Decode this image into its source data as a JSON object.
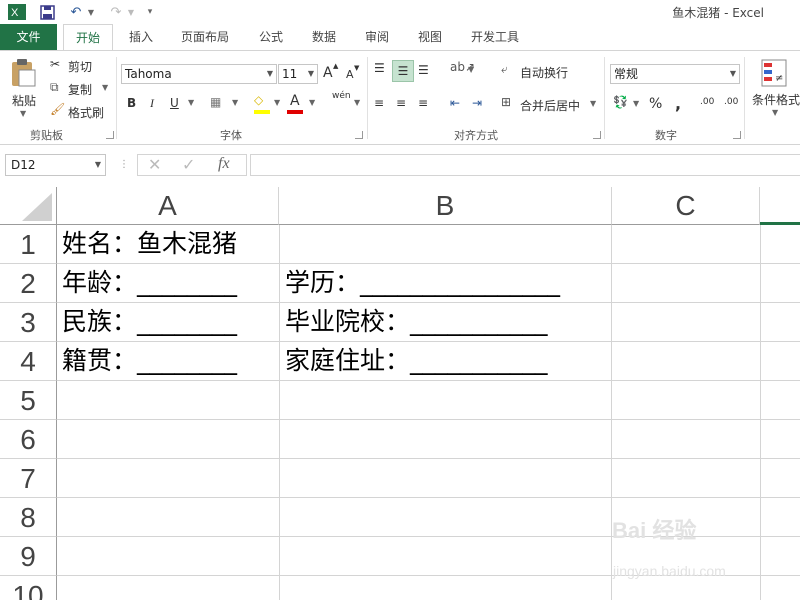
{
  "window": {
    "title": "鱼木混猪 - Excel"
  },
  "tabs": [
    {
      "label": "文件"
    },
    {
      "label": "开始"
    },
    {
      "label": "插入"
    },
    {
      "label": "页面布局"
    },
    {
      "label": "公式"
    },
    {
      "label": "数据"
    },
    {
      "label": "审阅"
    },
    {
      "label": "视图"
    },
    {
      "label": "开发工具"
    }
  ],
  "ribbon": {
    "clipboard": {
      "group_label": "剪贴板",
      "paste": "粘贴",
      "cut": "剪切",
      "copy": "复制",
      "format_painter": "格式刷"
    },
    "font": {
      "group_label": "字体",
      "font_name": "Tahoma",
      "font_size": "11",
      "bold": "B",
      "italic": "I",
      "underline": "U",
      "grow": "A",
      "shrink": "A",
      "font_color": "A",
      "phonetic": "wén"
    },
    "alignment": {
      "group_label": "对齐方式",
      "wrap_text": "自动换行",
      "merge_center": "合并后居中"
    },
    "number": {
      "group_label": "数字",
      "format": "常规",
      "percent": "%",
      "comma": ",",
      "inc_decimal": ".00",
      "dec_decimal": ".00"
    },
    "styles": {
      "conditional_format": "条件格式"
    }
  },
  "formula_bar": {
    "name_box": "D12",
    "fx": "fx",
    "value": ""
  },
  "columns": [
    "A",
    "B",
    "C"
  ],
  "rows": [
    "1",
    "2",
    "3",
    "4",
    "5",
    "6",
    "7",
    "8",
    "9",
    "10"
  ],
  "cells": {
    "A1": "姓名：鱼木混猪",
    "A2": "年龄：________",
    "B2": "学历：________________",
    "A3": "民族：________",
    "B3": "毕业院校：___________",
    "A4": "籍贯：________",
    "B4": "家庭住址：___________"
  },
  "watermark": {
    "main": "Bai 经验",
    "sub": "jingyan.baidu.com"
  },
  "colors": {
    "accent": "#217346",
    "grid": "#d4d4d4"
  }
}
